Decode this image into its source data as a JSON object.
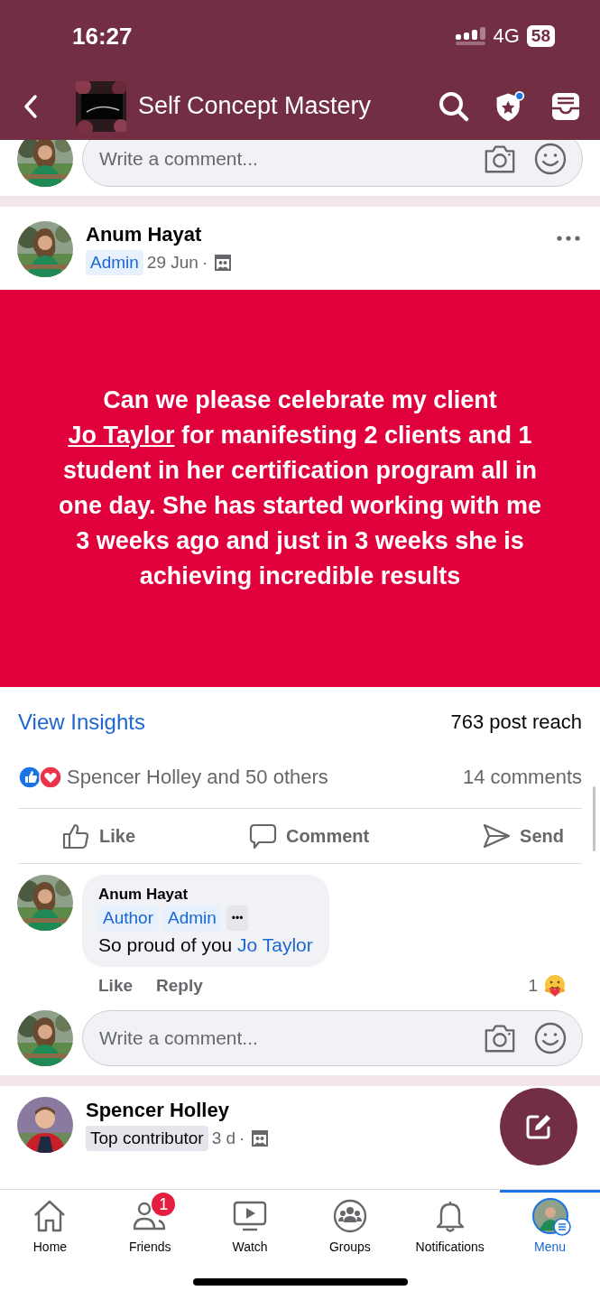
{
  "status_bar": {
    "time": "16:27",
    "network": "4G",
    "battery": "58"
  },
  "header": {
    "title": "Self Concept Mastery"
  },
  "top_composer": {
    "placeholder": "Write a comment..."
  },
  "post": {
    "author": "Anum Hayat",
    "role_badge": "Admin",
    "date": "29 Jun",
    "separator": "·",
    "banner": {
      "before": "Can we please celebrate my client",
      "mention": "Jo Taylor",
      "after": "for manifesting 2 clients and 1 student in her certification program all in one day. She has started working with me 3 weeks ago and just in 3 weeks she is achieving incredible results"
    },
    "insights_link": "View Insights",
    "reach": "763 post reach",
    "reactions_text": "Spencer Holley and 50 others",
    "comments_count": "14 comments",
    "actions": [
      {
        "kind": "like",
        "label": "Like"
      },
      {
        "kind": "comment",
        "label": "Comment"
      },
      {
        "kind": "send",
        "label": "Send"
      }
    ],
    "comment": {
      "author": "Anum Hayat",
      "badges": [
        "Author",
        "Admin"
      ],
      "more": "•••",
      "text": "So proud of you",
      "mention": "Jo Taylor",
      "like": "Like",
      "reply": "Reply",
      "reaction_count": "1"
    },
    "composer": {
      "placeholder": "Write a comment..."
    }
  },
  "next_post": {
    "author": "Spencer Holley",
    "badge": "Top contributor",
    "date": "3 d",
    "separator": "·"
  },
  "tabs": [
    {
      "kind": "home",
      "label": "Home",
      "selected": false
    },
    {
      "kind": "friends",
      "label": "Friends",
      "selected": false,
      "badge": "1"
    },
    {
      "kind": "watch",
      "label": "Watch",
      "selected": false
    },
    {
      "kind": "groups",
      "label": "Groups",
      "selected": false
    },
    {
      "kind": "bell",
      "label": "Notifications",
      "selected": false
    },
    {
      "kind": "menu",
      "label": "Menu",
      "selected": true
    }
  ]
}
